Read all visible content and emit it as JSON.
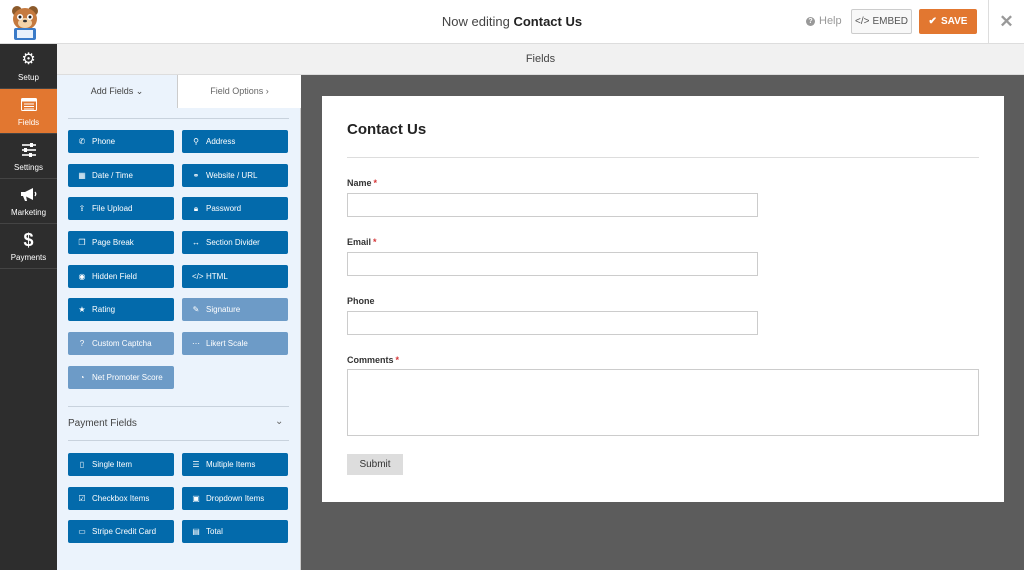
{
  "header": {
    "title_prefix": "Now editing",
    "title_form": "Contact Us",
    "help_label": "Help",
    "embed_label": "EMBED",
    "save_label": "SAVE"
  },
  "nav": {
    "items": [
      {
        "label": "Setup",
        "icon": "gear-icon"
      },
      {
        "label": "Fields",
        "icon": "fields-list-icon",
        "active": true
      },
      {
        "label": "Settings",
        "icon": "sliders-icon"
      },
      {
        "label": "Marketing",
        "icon": "megaphone-icon"
      },
      {
        "label": "Payments",
        "icon": "dollar-icon"
      }
    ]
  },
  "subheader": {
    "title": "Fields"
  },
  "sidebar": {
    "tab_add": "Add Fields",
    "tab_options": "Field Options",
    "fields": [
      {
        "label": "Phone",
        "icon": "phone-icon"
      },
      {
        "label": "Address",
        "icon": "map-pin-icon"
      },
      {
        "label": "Date / Time",
        "icon": "calendar-icon"
      },
      {
        "label": "Website / URL",
        "icon": "link-icon"
      },
      {
        "label": "File Upload",
        "icon": "upload-icon"
      },
      {
        "label": "Password",
        "icon": "lock-icon"
      },
      {
        "label": "Page Break",
        "icon": "copy-icon"
      },
      {
        "label": "Section Divider",
        "icon": "divider-icon"
      },
      {
        "label": "Hidden Field",
        "icon": "eye-slash-icon"
      },
      {
        "label": "HTML",
        "icon": "code-icon"
      },
      {
        "label": "Rating",
        "icon": "star-icon"
      },
      {
        "label": "Signature",
        "icon": "pen-icon",
        "disabled": true
      },
      {
        "label": "Custom Captcha",
        "icon": "question-icon",
        "disabled": true
      },
      {
        "label": "Likert Scale",
        "icon": "ellipsis-icon",
        "disabled": true
      },
      {
        "label": "Net Promoter Score",
        "icon": "gauge-icon",
        "disabled": true
      }
    ],
    "payment_title": "Payment Fields",
    "payment_fields": [
      {
        "label": "Single Item",
        "icon": "file-icon"
      },
      {
        "label": "Multiple Items",
        "icon": "list-icon"
      },
      {
        "label": "Checkbox Items",
        "icon": "checkbox-icon"
      },
      {
        "label": "Dropdown Items",
        "icon": "dropdown-icon"
      },
      {
        "label": "Stripe Credit Card",
        "icon": "credit-card-icon"
      },
      {
        "label": "Total",
        "icon": "money-icon"
      }
    ]
  },
  "form": {
    "title": "Contact Us",
    "fields": [
      {
        "label": "Name",
        "required": "*"
      },
      {
        "label": "Email",
        "required": "*"
      },
      {
        "label": "Phone",
        "required": ""
      },
      {
        "label": "Comments",
        "required": "*"
      }
    ],
    "submit_label": "Submit"
  },
  "colors": {
    "accent": "#e27730",
    "field_button": "#036aab",
    "field_button_disabled": "#6d9bc7",
    "nav_bg": "#2d2d2d",
    "canvas_bg": "#5c5c5c",
    "required": "#d63638"
  }
}
